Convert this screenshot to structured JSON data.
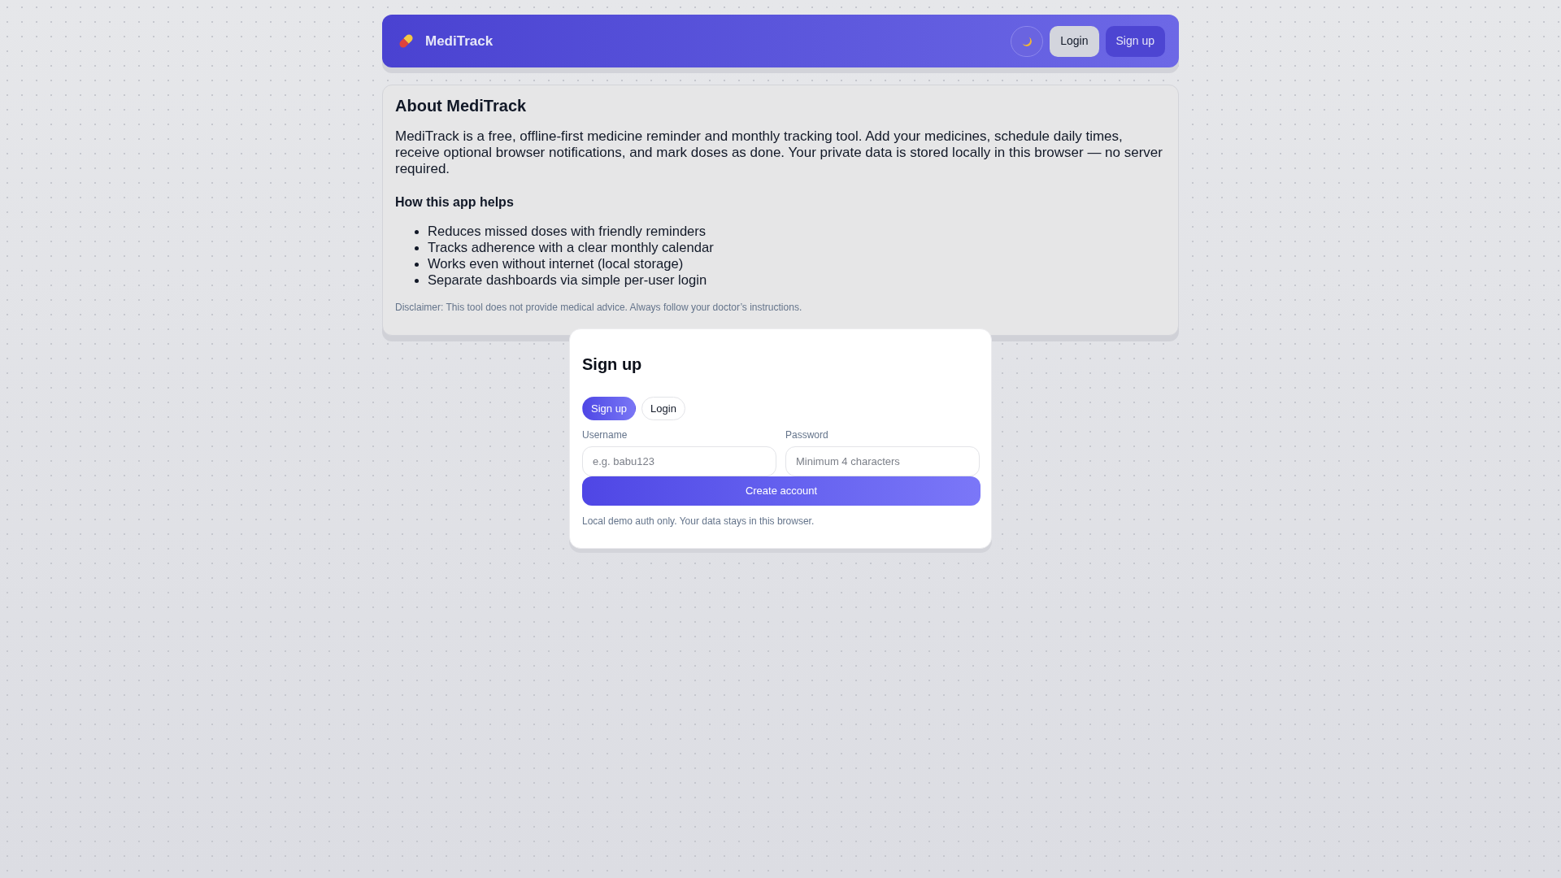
{
  "header": {
    "brand": "MediTrack",
    "buttons": [
      {
        "label": "Login",
        "kind": "secondary"
      },
      {
        "label": "Sign up",
        "kind": "primary"
      }
    ]
  },
  "about": {
    "title": "About MediTrack",
    "description": "MediTrack is a free, offline-first medicine reminder and monthly tracking tool. Add your medicines, schedule daily times, receive optional browser notifications, and mark doses as done. Your private data is stored locally in this browser — no server required.",
    "subheading": "How this app helps",
    "benefits": [
      "Reduces missed doses with friendly reminders",
      "Tracks adherence with a clear monthly calendar",
      "Works even without internet (local storage)",
      "Separate dashboards via simple per-user login"
    ],
    "disclaimer": "Disclaimer: This tool does not provide medical advice. Always follow your doctor’s instructions."
  },
  "auth_card": {
    "title": "Sign up",
    "tabs": [
      {
        "label": "Sign up",
        "selected": true
      },
      {
        "label": "Login",
        "selected": false
      }
    ],
    "fields": [
      {
        "label": "Username",
        "placeholder": "e.g. babu123"
      },
      {
        "label": "Password",
        "placeholder": "Minimum 4 characters"
      }
    ],
    "submit": "Create account",
    "note": "Local demo auth only. Your data stays in this browser."
  }
}
